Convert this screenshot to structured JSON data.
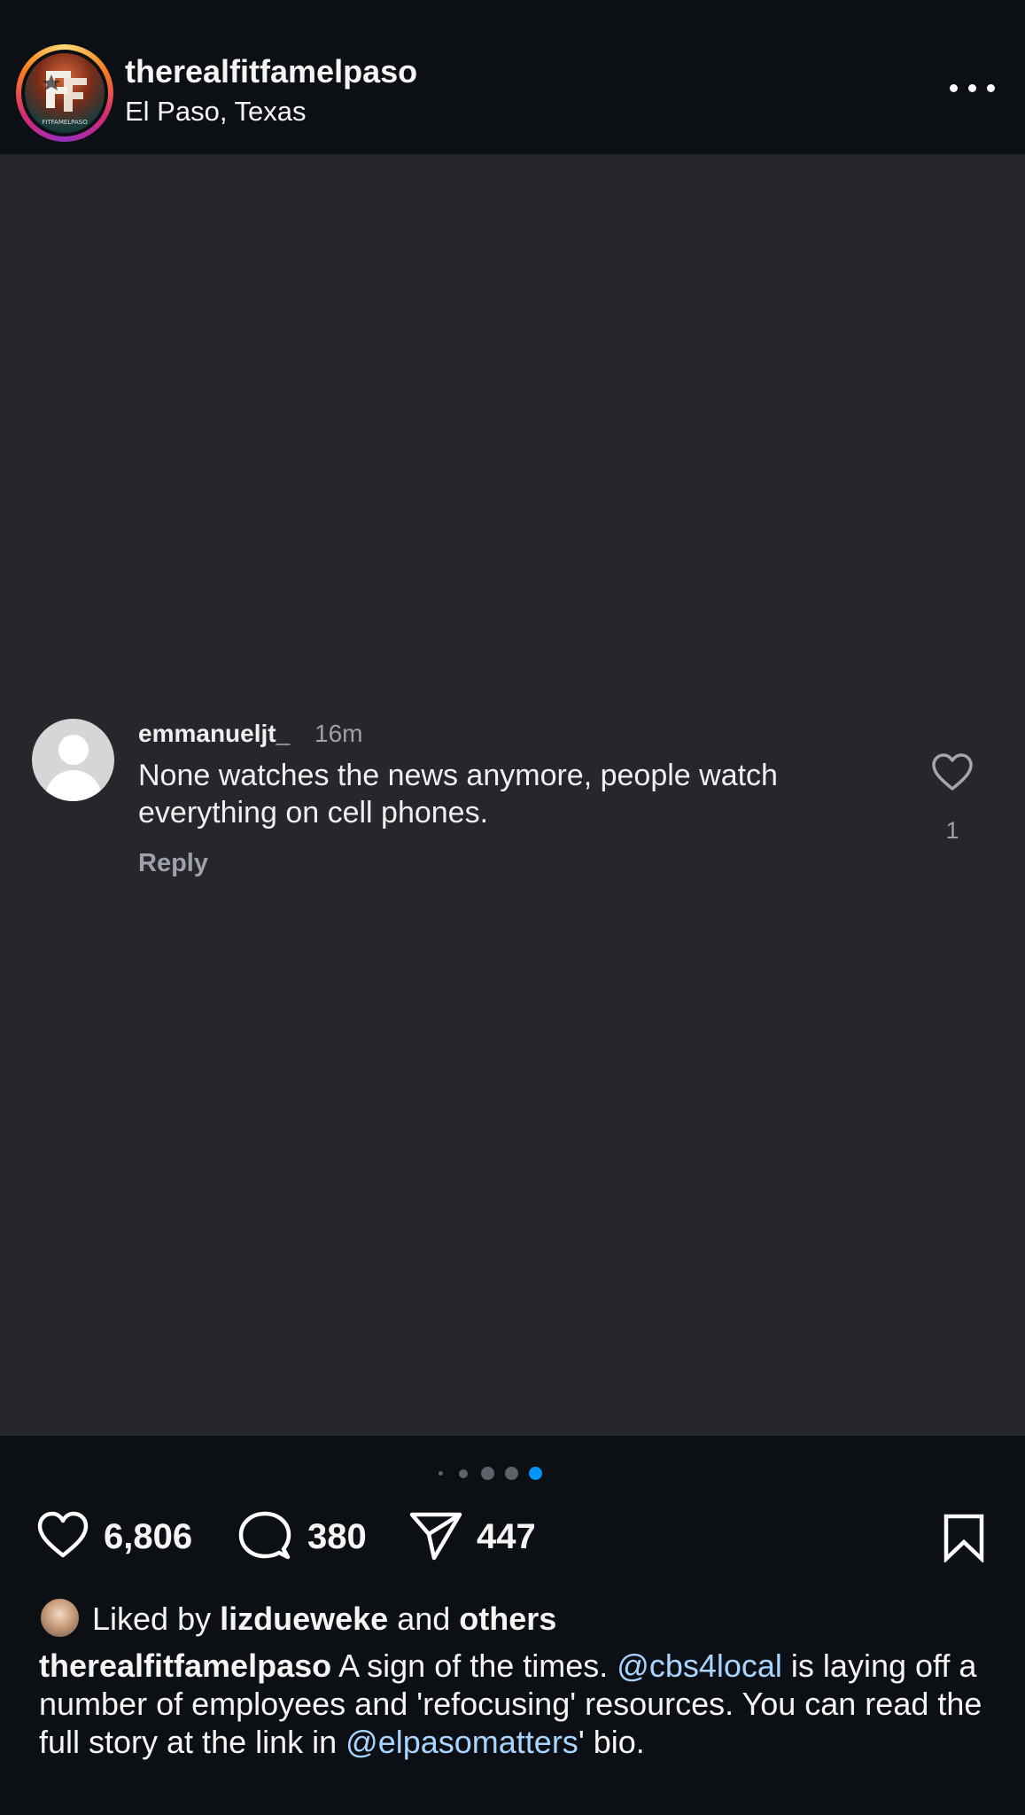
{
  "header": {
    "username": "therealfitfamelpaso",
    "location": "El Paso, Texas",
    "avatar_text": "FITFAMELPASO"
  },
  "comment": {
    "username": "emmanueljt_",
    "time": "16m",
    "text": "None watches the news anymore, people watch everything on cell phones.",
    "reply_label": "Reply",
    "like_count": "1"
  },
  "carousel": {
    "total": 5,
    "active_index": 4
  },
  "actions": {
    "likes": "6,806",
    "comments": "380",
    "shares": "447"
  },
  "liked_by": {
    "prefix": "Liked by",
    "user": "lizdueweke",
    "and": "and",
    "others": "others"
  },
  "caption": {
    "username": "therealfitfamelpaso",
    "text_1": " A sign of the times. ",
    "mention_1": "@cbs4local",
    "text_2": " is laying off a number of employees and 'refocusing' resources. You can read the full story at the link in ",
    "mention_2": "@elpasomatters",
    "text_3": "' bio."
  },
  "colors": {
    "background": "#0c1014",
    "media_background": "#25272d",
    "accent_blue": "#0095f6",
    "muted_text": "#9ea1a7"
  },
  "icons": [
    "more-icon",
    "heart-icon",
    "comment-icon",
    "share-icon",
    "bookmark-icon"
  ]
}
